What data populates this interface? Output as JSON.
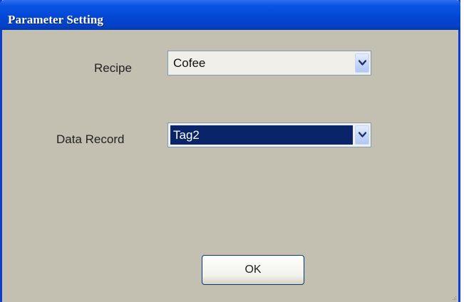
{
  "window": {
    "title": "Parameter Setting"
  },
  "form": {
    "recipe": {
      "label": "Recipe",
      "value": "Cofee"
    },
    "data_record": {
      "label": "Data Record",
      "value": "Tag2"
    }
  },
  "buttons": {
    "ok_label": "OK"
  },
  "colors": {
    "titlebar": "#0347d6",
    "client_background": "#c4c0b1",
    "selection_highlight": "#0a246a"
  },
  "icons": {
    "dropdown": "chevron-down-icon",
    "resize": "resize-grip-icon"
  }
}
